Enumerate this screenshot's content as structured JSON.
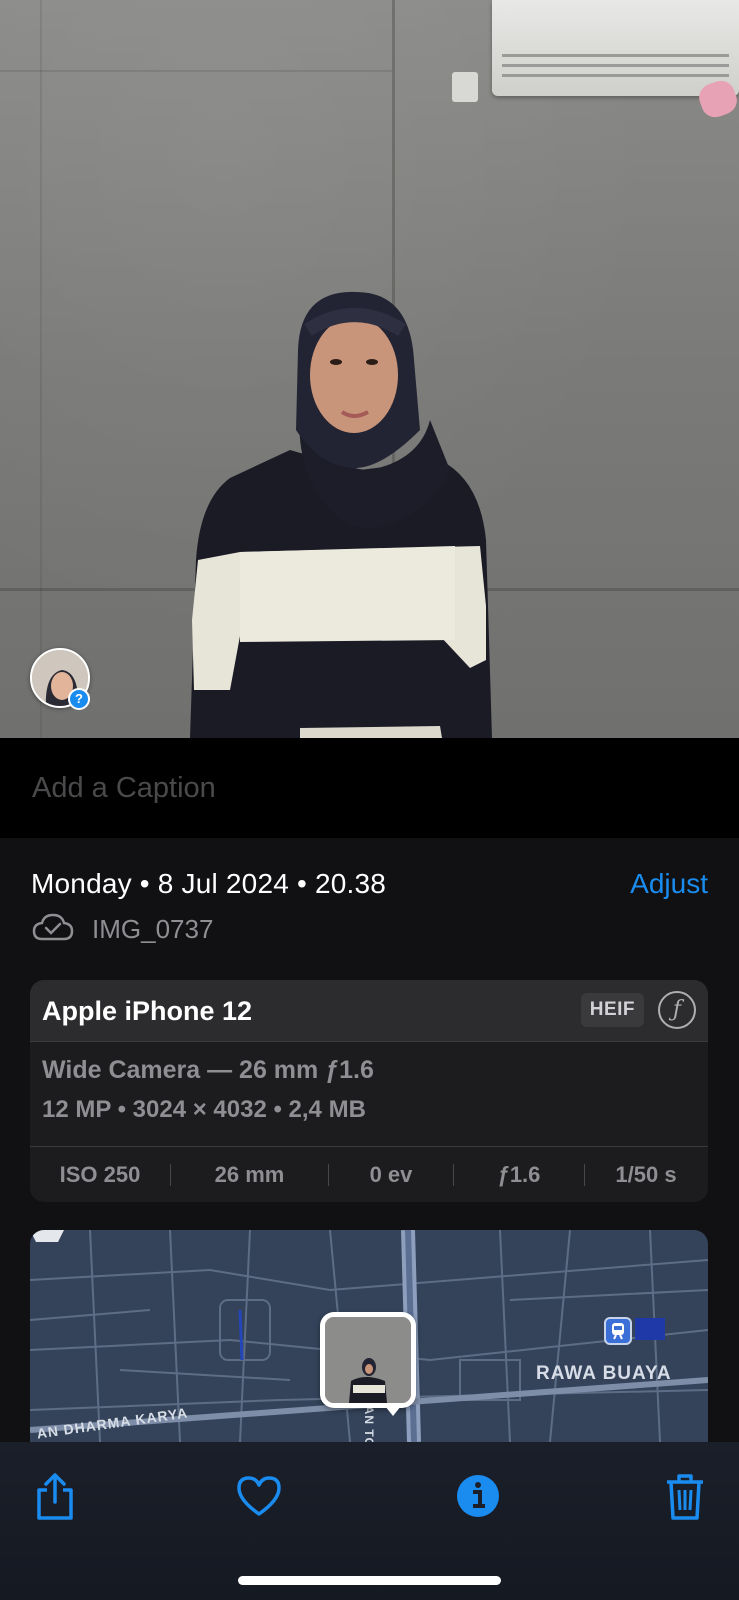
{
  "photo": {
    "face_badge_label": "?"
  },
  "caption": {
    "placeholder": "Add a Caption"
  },
  "info": {
    "date_line": "Monday • 8 Jul 2024 • 20.38",
    "adjust_label": "Adjust",
    "filename": "IMG_0737",
    "device": {
      "name": "Apple iPhone 12",
      "format_badge": "HEIF",
      "lens": "Wide Camera — 26 mm ƒ1.6",
      "specs": "12 MP  •  3024 × 4032  •  2,4 MB",
      "exif": {
        "iso": "ISO 250",
        "focal": "26 mm",
        "ev": "0 ev",
        "aperture": "ƒ1.6",
        "shutter": "1/50 s"
      },
      "f_icon_glyph": "ƒ"
    },
    "map": {
      "label_rawa_buaya": "RAWA BUAYA",
      "label_dharma_karya": "AN DHARMA KARYA",
      "label_vertical": "JALAN TO"
    }
  },
  "toolbar": {
    "icons": [
      "share-icon",
      "heart-icon",
      "info-icon",
      "trash-icon"
    ]
  },
  "colors": {
    "accent": "#1a8cf0",
    "sheet_bg": "#111113",
    "card_bg": "#1c1c1e",
    "map_bg": "#34435a",
    "toolbar_bg": "#1a1f29"
  }
}
